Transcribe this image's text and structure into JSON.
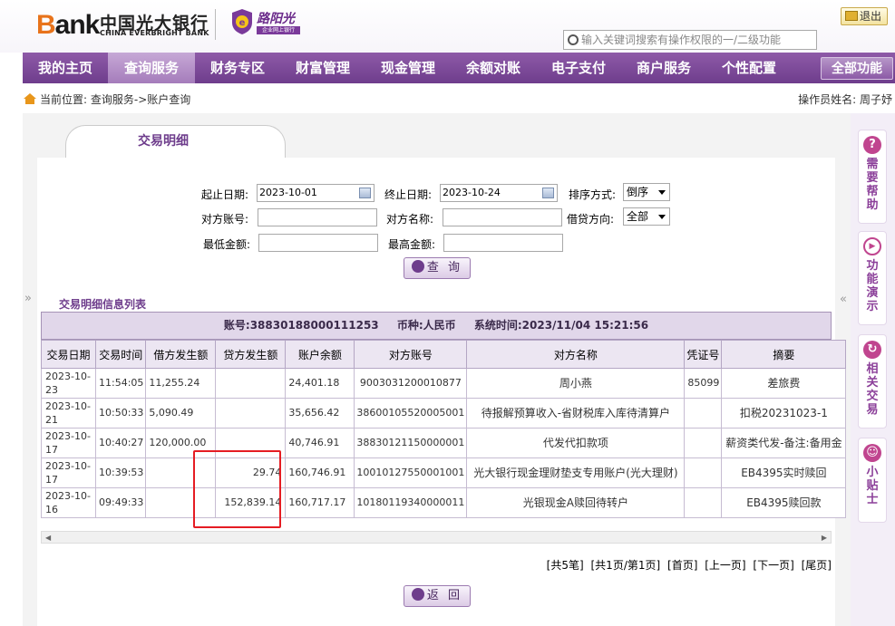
{
  "header": {
    "brand_text": "Bank",
    "bank_cn": "中国光大银行",
    "bank_en": "CHINA EVERBRIGHT BANK",
    "product_name": "路阳光",
    "product_sub": "企业网上银行",
    "logout_label": "退出",
    "search_placeholder": "输入关键词搜索有操作权限的一/二级功能"
  },
  "nav": {
    "items": [
      "我的主页",
      "查询服务",
      "财务专区",
      "财富管理",
      "现金管理",
      "余额对账",
      "电子支付",
      "商户服务",
      "个性配置"
    ],
    "active": "查询服务",
    "all_label": "全部功能"
  },
  "breadcrumb": {
    "prefix": "当前位置:",
    "path": "查询服务->账户查询",
    "operator_label": "操作员姓名:",
    "operator_name": "周子妤"
  },
  "tab": {
    "title": "交易明细"
  },
  "form": {
    "start_date_label": "起止日期:",
    "start_date": "2023-10-01",
    "end_date_label": "终止日期:",
    "end_date": "2023-10-24",
    "sort_label": "排序方式:",
    "sort_value": "倒序",
    "counter_account_label": "对方账号:",
    "counter_name_label": "对方名称:",
    "direction_label": "借贷方向:",
    "direction_value": "全部",
    "min_amount_label": "最低金额:",
    "max_amount_label": "最高金额:",
    "query_label": "查 询"
  },
  "list": {
    "title": "交易明细信息列表",
    "account_info": "账号:38830188000111253",
    "currency_info": "币种:人民币",
    "system_time": "系统时间:2023/11/04 15:21:56",
    "columns": [
      "交易日期",
      "交易时间",
      "借方发生额",
      "贷方发生额",
      "账户余额",
      "对方账号",
      "对方名称",
      "凭证号",
      "摘要"
    ],
    "rows": [
      {
        "date": "2023-10-23",
        "time": "11:54:05",
        "debit": "11,255.24",
        "credit": "",
        "balance": "24,401.18",
        "counter_account": "9003031200010877",
        "counter_name": "周小燕",
        "voucher": "85099",
        "memo": "差旅费"
      },
      {
        "date": "2023-10-21",
        "time": "10:50:33",
        "debit": "5,090.49",
        "credit": "",
        "balance": "35,656.42",
        "counter_account": "38600105520005001",
        "counter_name": "待报解预算收入-省财税库入库待清算户",
        "voucher": "",
        "memo": "扣税20231023-1"
      },
      {
        "date": "2023-10-17",
        "time": "10:40:27",
        "debit": "120,000.00",
        "credit": "",
        "balance": "40,746.91",
        "counter_account": "38830121150000001",
        "counter_name": "代发代扣款项",
        "voucher": "",
        "memo": "薪资类代发-备注:备用金"
      },
      {
        "date": "2023-10-17",
        "time": "10:39:53",
        "debit": "",
        "credit": "29.74",
        "balance": "160,746.91",
        "counter_account": "10010127550001001",
        "counter_name": "光大银行现金理财垫支专用账户(光大理财)",
        "voucher": "",
        "memo": "EB4395实时赎回"
      },
      {
        "date": "2023-10-16",
        "time": "09:49:33",
        "debit": "",
        "credit": "152,839.14",
        "balance": "160,717.17",
        "counter_account": "10180119340000011",
        "counter_name": "光银现金A赎回待转户",
        "voucher": "",
        "memo": "EB4395赎回款"
      }
    ]
  },
  "pager": {
    "total": "[共5笔]",
    "pages": "[共1页/第1页]",
    "first": "[首页]",
    "prev": "[上一页]",
    "next": "[下一页]",
    "last": "[尾页]"
  },
  "back_label": "返 回",
  "sidebar": {
    "help": "需要帮助",
    "demo": "功能演示",
    "related": "相关交易",
    "tips": "小贴士"
  },
  "colors": {
    "brand_purple": "#6e3d8c",
    "highlight_red": "#e51c23",
    "brand_orange": "#e8731b"
  }
}
